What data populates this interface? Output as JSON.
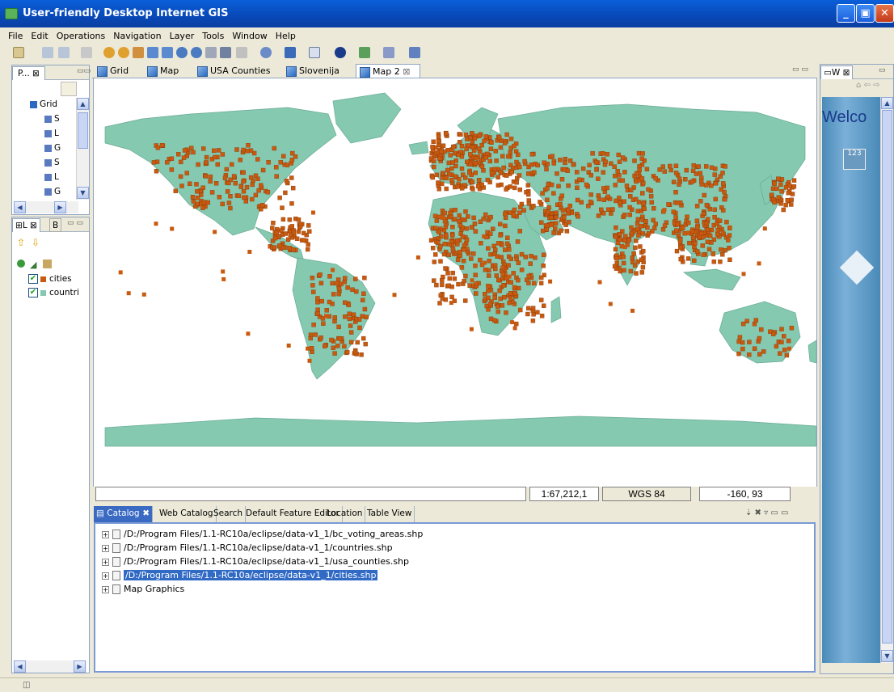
{
  "window": {
    "title": "User-friendly Desktop Internet GIS"
  },
  "menu": [
    "File",
    "Edit",
    "Operations",
    "Navigation",
    "Layer",
    "Tools",
    "Window",
    "Help"
  ],
  "projects_panel": {
    "tab_label": "P...",
    "tree": [
      {
        "label": "Grid",
        "indent": 0
      },
      {
        "label": "S",
        "indent": 1
      },
      {
        "label": "L",
        "indent": 1
      },
      {
        "label": "G",
        "indent": 1
      },
      {
        "label": "S",
        "indent": 1
      },
      {
        "label": "L",
        "indent": 1
      },
      {
        "label": "G",
        "indent": 1
      }
    ]
  },
  "layers_panel": {
    "tab_l": "L",
    "tab_b": "B",
    "layers": [
      {
        "name": "cities",
        "checked": true
      },
      {
        "name": "countri",
        "checked": true
      }
    ]
  },
  "map_tabs": [
    "Grid",
    "Map",
    "USA Counties",
    "Slovenija",
    "Map 2"
  ],
  "map": {
    "land_color": "#85c9b1",
    "city_color": "#c85a10",
    "background": "#ffffff"
  },
  "status": {
    "scale": "1:67,212,1",
    "crs": "WGS 84",
    "coord": "-160, 93"
  },
  "bottom_tabs": [
    "Catalog",
    "Web Catalog",
    "Search",
    "Default Feature Editor",
    "Location",
    "Table View"
  ],
  "catalog": [
    {
      "path": "/D:/Program Files/1.1-RC10a/eclipse/data-v1_1/bc_voting_areas.shp",
      "selected": false
    },
    {
      "path": "/D:/Program Files/1.1-RC10a/eclipse/data-v1_1/countries.shp",
      "selected": false
    },
    {
      "path": "/D:/Program Files/1.1-RC10a/eclipse/data-v1_1/usa_counties.shp",
      "selected": false
    },
    {
      "path": "/D:/Program Files/1.1-RC10a/eclipse/data-v1_1/cities.shp",
      "selected": true
    },
    {
      "path": "Map Graphics",
      "selected": false
    }
  ],
  "welcome": {
    "tab_label": "W",
    "text": "Welco"
  }
}
